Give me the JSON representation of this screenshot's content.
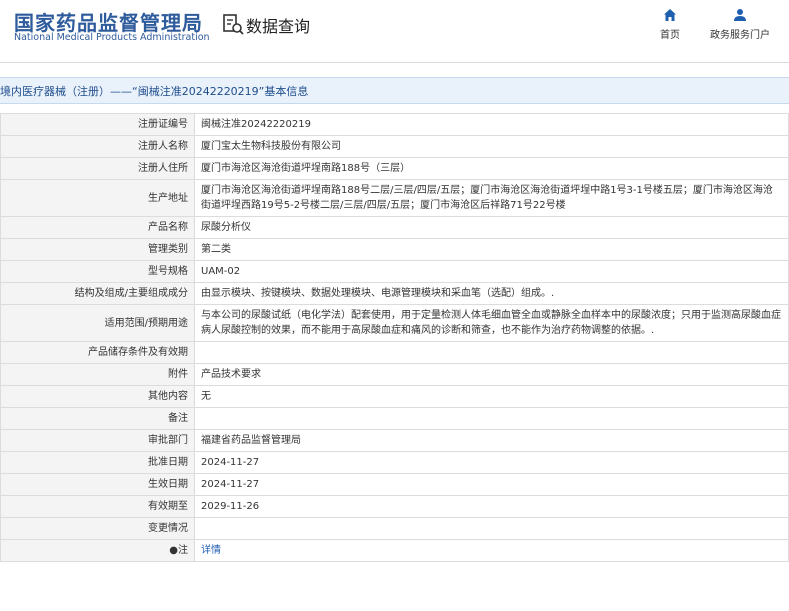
{
  "header": {
    "logo_cn": "国家药品监督管理局",
    "logo_en": "National Medical Products Administration",
    "page_title": "数据查询",
    "nav": [
      {
        "label": "首页",
        "icon": "home-icon"
      },
      {
        "label": "政务服务门户",
        "icon": "user-icon"
      }
    ]
  },
  "breadcrumb": "境内医疗器械（注册）——“闽械注准20242220219”基本信息",
  "rows": [
    {
      "label": "注册证编号",
      "value": "闽械注准20242220219"
    },
    {
      "label": "注册人名称",
      "value": "厦门宝太生物科技股份有限公司"
    },
    {
      "label": "注册人住所",
      "value": "厦门市海沧区海沧街道坪埕南路188号（三层）"
    },
    {
      "label": "生产地址",
      "value": "厦门市海沧区海沧街道坪埕南路188号二层/三层/四层/五层；厦门市海沧区海沧街道坪埕中路1号3-1号楼五层；厦门市海沧区海沧街道坪埕西路19号5-2号楼二层/三层/四层/五层；厦门市海沧区后祥路71号22号楼"
    },
    {
      "label": "产品名称",
      "value": "尿酸分析仪"
    },
    {
      "label": "管理类别",
      "value": "第二类"
    },
    {
      "label": "型号规格",
      "value": "UAM-02"
    },
    {
      "label": "结构及组成/主要组成成分",
      "value": "由显示模块、按键模块、数据处理模块、电源管理模块和采血笔（选配）组成。."
    },
    {
      "label": "适用范围/预期用途",
      "value": "与本公司的尿酸试纸（电化学法）配套使用，用于定量检测人体毛细血管全血或静脉全血样本中的尿酸浓度；只用于监测高尿酸血症病人尿酸控制的效果，而不能用于高尿酸血症和痛风的诊断和筛查，也不能作为治疗药物调整的依据。."
    },
    {
      "label": "产品储存条件及有效期",
      "value": ""
    },
    {
      "label": "附件",
      "value": "产品技术要求"
    },
    {
      "label": "其他内容",
      "value": "无"
    },
    {
      "label": "备注",
      "value": ""
    },
    {
      "label": "审批部门",
      "value": "福建省药品监督管理局"
    },
    {
      "label": "批准日期",
      "value": "2024-11-27"
    },
    {
      "label": "生效日期",
      "value": "2024-11-27"
    },
    {
      "label": "有效期至",
      "value": "2029-11-26"
    },
    {
      "label": "变更情况",
      "value": ""
    },
    {
      "label": "●注",
      "value": "详情"
    }
  ],
  "colors": {
    "brand": "#2e5b9c",
    "title_bar_bg": "#e9f1fb",
    "link": "#1f5fb0",
    "label_bg": "#f4f4f4"
  }
}
